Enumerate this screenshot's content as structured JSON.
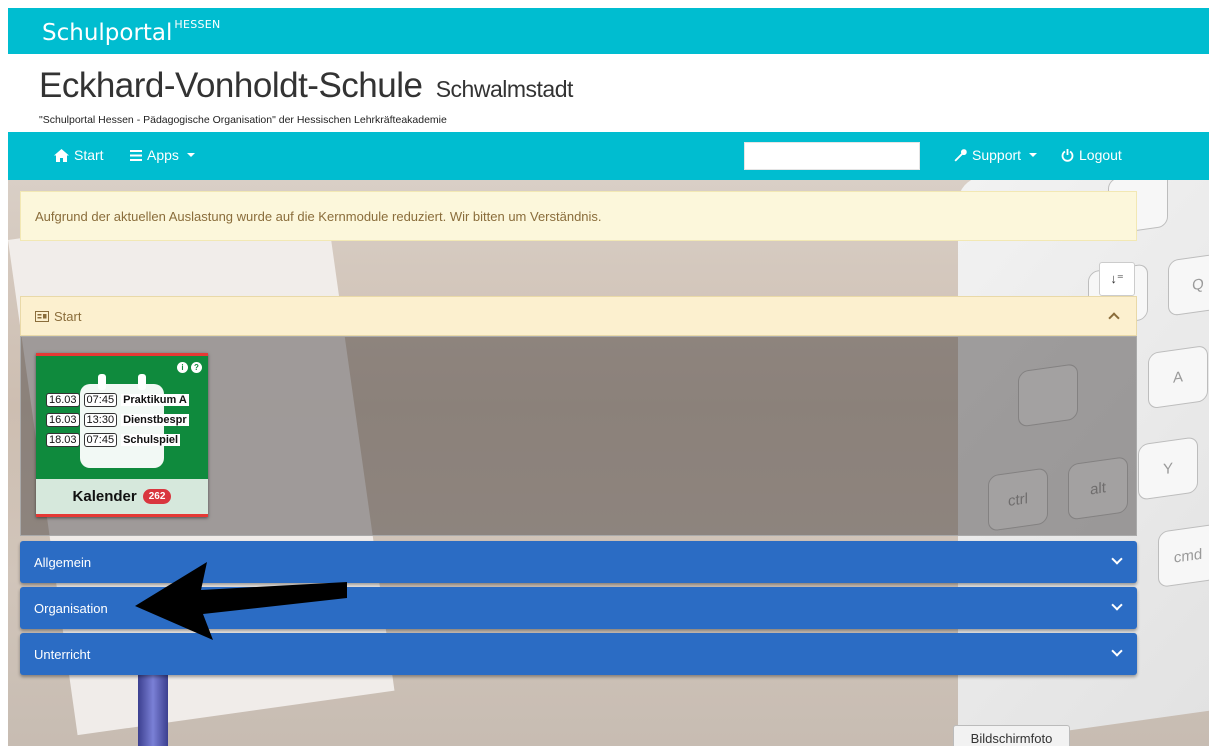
{
  "brand": {
    "name": "Schulportal",
    "region": "HESSEN"
  },
  "school": {
    "name": "Eckhard-Vonholdt-Schule",
    "city": "Schwalmstadt",
    "subtitle": "\"Schulportal Hessen - Pädagogische Organisation\" der Hessischen Lehrkräfteakademie"
  },
  "nav": {
    "start_label": "Start",
    "apps_label": "Apps",
    "support_label": "Support",
    "logout_label": "Logout",
    "search_value": ""
  },
  "notice": {
    "text": "Aufgrund der aktuellen Auslastung wurde auf die Kernmodule reduziert. Wir bitten um Verständnis."
  },
  "start_panel": {
    "title": "Start"
  },
  "calendar_tile": {
    "title": "Kalender",
    "count": "262",
    "events": [
      {
        "date": "16.03",
        "time": "07:45",
        "title": "Praktikum A"
      },
      {
        "date": "16.03",
        "time": "13:30",
        "title": "Dienstbespr"
      },
      {
        "date": "18.03",
        "time": "07:45",
        "title": "Schulspiel"
      }
    ]
  },
  "sections": [
    {
      "label": "Allgemein"
    },
    {
      "label": "Organisation"
    },
    {
      "label": "Unterricht"
    }
  ],
  "keyboard_keys": [
    "Q",
    "A",
    "Y",
    "ctrl",
    "alt",
    "cmd"
  ],
  "screenshot_button": {
    "label": "Bildschirmfoto"
  },
  "colors": {
    "brand": "#00bdd0",
    "section": "#2b6cc4",
    "tile": "#0f8a3d",
    "badge": "#d9363e"
  }
}
